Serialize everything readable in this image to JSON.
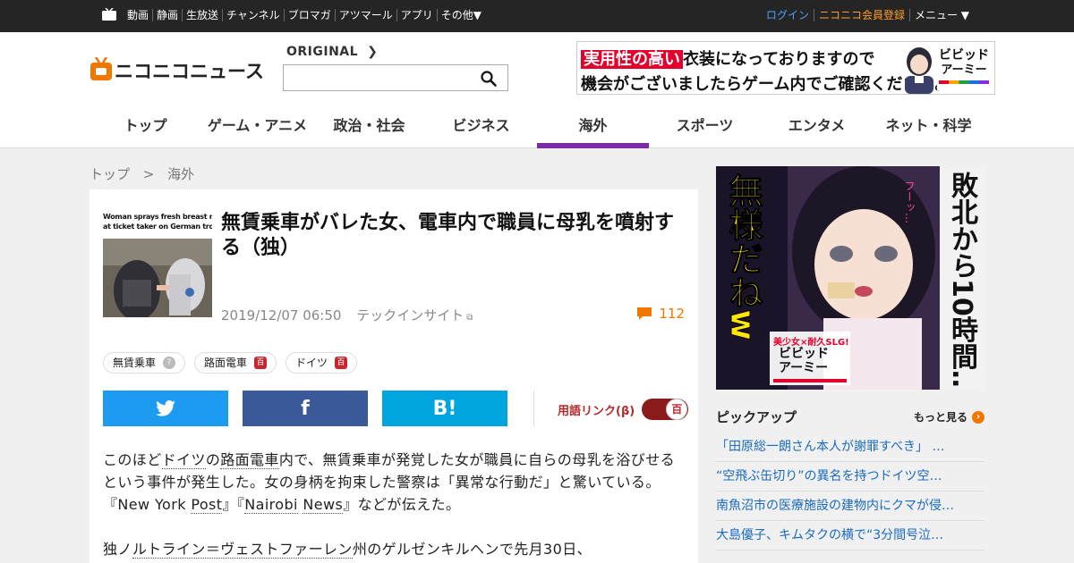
{
  "topbar": {
    "links": [
      "動画",
      "静画",
      "生放送",
      "チャンネル",
      "ブロマガ",
      "アツマール",
      "アプリ",
      "その他▼"
    ],
    "login": "ログイン",
    "register": "ニコニコ会員登録",
    "menu": "メニュー ▼"
  },
  "header": {
    "logo_text": "ニコニコニュース",
    "original_label": "ORIGINAL",
    "search_value": "",
    "ad": {
      "line1_highlight": "実用性の高い",
      "line1_rest": "衣装になっておりますので",
      "line2": "機会がございましたらゲーム内でご確認ください。",
      "brand_line1": "ビビッド",
      "brand_line2": "アーミー"
    }
  },
  "nav": {
    "tabs": [
      "トップ",
      "ゲーム・アニメ",
      "政治・社会",
      "ビジネス",
      "海外",
      "スポーツ",
      "エンタメ",
      "ネット・科学"
    ],
    "active_index": 4
  },
  "breadcrumb": {
    "home": "トップ",
    "sep": ">",
    "current": "海外"
  },
  "article": {
    "thumb_caption_1": "Woman sprays fresh breast milk",
    "thumb_caption_2": "at ticket taker on German trolley",
    "title": "無賃乗車がバレた女、電車内で職員に母乳を噴射する（独）",
    "date": "2019/12/07 06:50",
    "source": "テックインサイト",
    "comment_count": "112",
    "tags": [
      {
        "label": "無賃乗車",
        "badge": "?"
      },
      {
        "label": "路面電車",
        "badge": "百"
      },
      {
        "label": "ドイツ",
        "badge": "百"
      }
    ],
    "share": {
      "twitter": "twitter-bird",
      "facebook": "f",
      "hatena": "B!"
    },
    "yogo_link_label": "用語リンク(β)",
    "yogo_knob": "百",
    "p1": [
      {
        "t": "このほど",
        "u": false
      },
      {
        "t": "ドイツ",
        "u": true
      },
      {
        "t": "の",
        "u": false
      },
      {
        "t": "路面電車",
        "u": true
      },
      {
        "t": "内で、無賃乗車が発覚した女が職員に自らの母乳を浴びせるという事件が発生した。女の身柄を拘束した警察は「異常な行動だ」と驚いている。『New York ",
        "u": false
      },
      {
        "t": "Post",
        "u": true
      },
      {
        "t": "』『",
        "u": false
      },
      {
        "t": "Nairobi",
        "u": true
      },
      {
        "t": " ",
        "u": false
      },
      {
        "t": "News",
        "u": true
      },
      {
        "t": "』などが伝えた。",
        "u": false
      }
    ],
    "p2": [
      {
        "t": "独ノ",
        "u": false
      },
      {
        "t": "ルトライン＝ヴェストファーレン",
        "u": true
      },
      {
        "t": "州のゲルゼンキルヘンで先月30日、",
        "u": false
      }
    ]
  },
  "sidebar": {
    "ad": {
      "left_text": "無様だねw",
      "right_text": "敗北から10時間…",
      "sfx": "フーッ…",
      "tagline": "美少女×耐久SLG!",
      "brand_line1": "ビビッド",
      "brand_line2": "アーミー"
    },
    "pickup_title": "ピックアップ",
    "more_label": "もっと見る",
    "pickup_items": [
      "「田原総一朗さん本人が謝罪すべき」 …",
      "“空飛ぶ缶切り”の異名を持つドイツ空…",
      "南魚沼市の医療施設の建物内にクマが侵…",
      "大島優子、キムタクの横で“3分間号泣…"
    ]
  },
  "colors": {
    "accent_purple": "#7b2ca6",
    "brand_orange": "#f07800",
    "link_blue": "#1a6bbf",
    "hyakka_red": "#c8262e"
  }
}
